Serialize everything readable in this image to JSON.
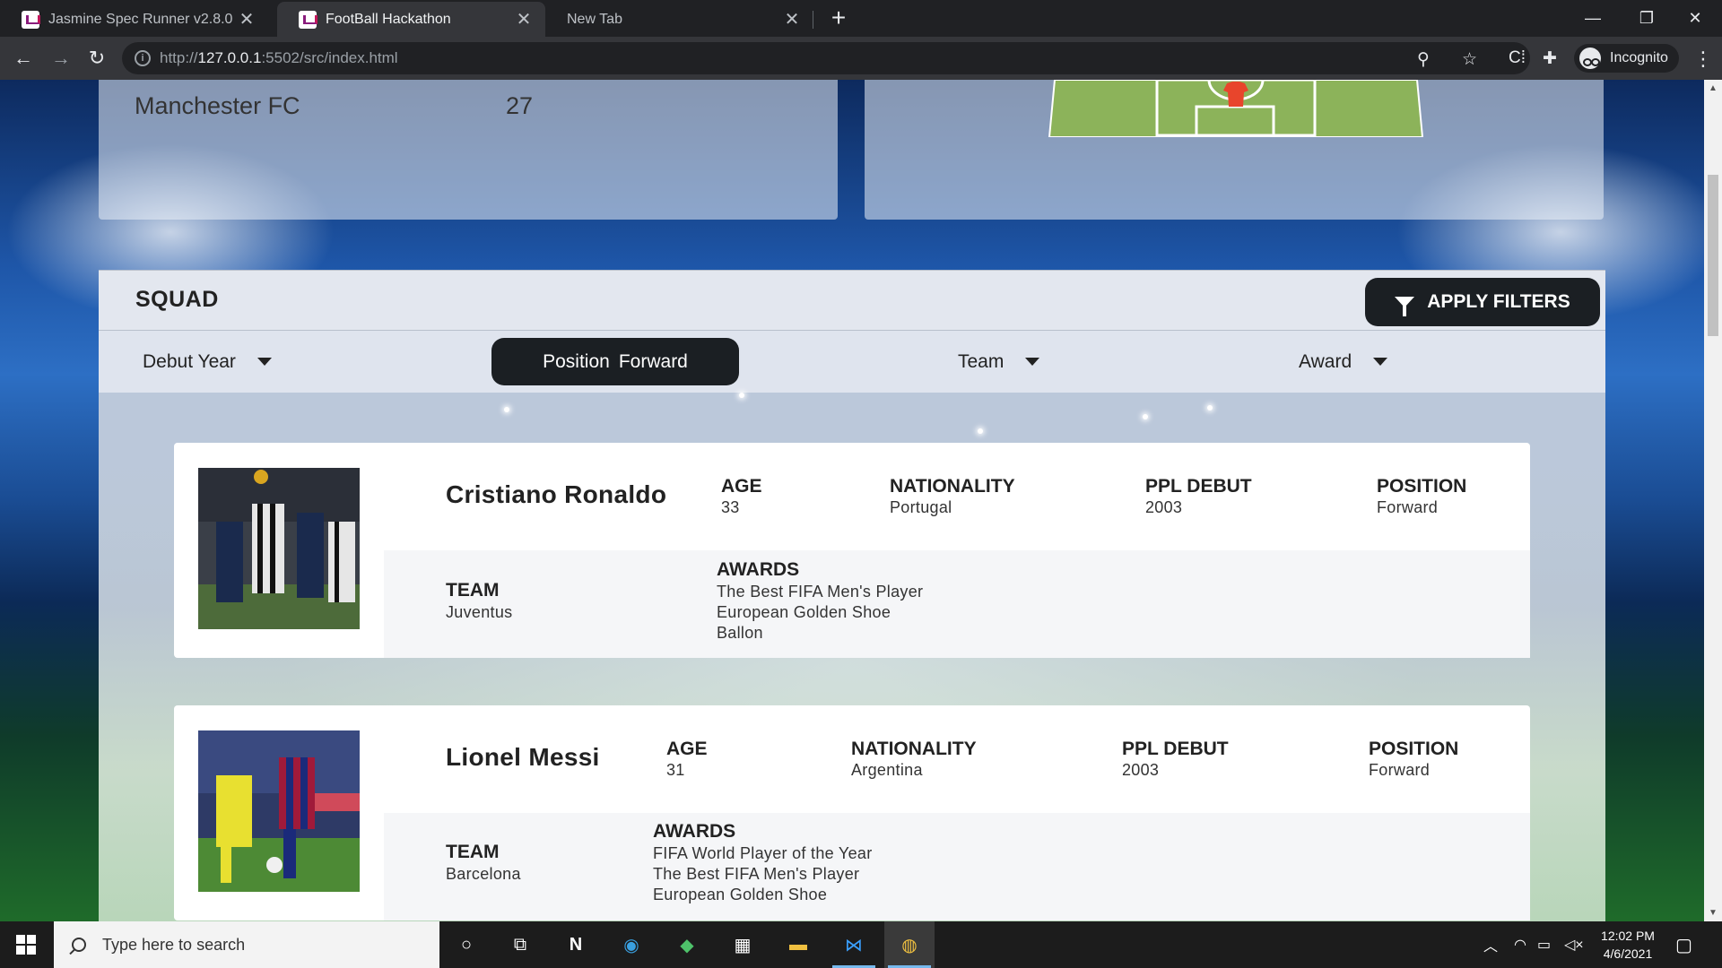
{
  "browser": {
    "tabs": [
      {
        "label": "Jasmine Spec Runner v2.8.0",
        "active": false
      },
      {
        "label": "FootBall Hackathon",
        "active": true
      },
      {
        "label": "New Tab",
        "active": false
      }
    ],
    "url_host": "127.0.0.1",
    "url_prefix": "http://",
    "url_rest": ":5502/src/index.html",
    "profile_label": "Incognito"
  },
  "team_card": {
    "name": "Manchester FC",
    "count": "27"
  },
  "squad": {
    "title": "SQUAD",
    "apply_filters_label": "APPLY FILTERS"
  },
  "filters": {
    "debut_year": "Debut Year",
    "position_label": "Position",
    "position_value": "Forward",
    "team": "Team",
    "award": "Award"
  },
  "labels": {
    "age": "AGE",
    "nationality": "NATIONALITY",
    "ppl_debut": "PPL DEBUT",
    "position": "POSITION",
    "team": "TEAM",
    "awards": "AWARDS"
  },
  "players": [
    {
      "name": "Cristiano Ronaldo",
      "age": "33",
      "nationality": "Portugal",
      "ppl_debut": "2003",
      "position": "Forward",
      "team": "Juventus",
      "awards": [
        "The Best FIFA Men's Player",
        "European Golden Shoe",
        "Ballon"
      ]
    },
    {
      "name": "Lionel Messi",
      "age": "31",
      "nationality": "Argentina",
      "ppl_debut": "2003",
      "position": "Forward",
      "team": "Barcelona",
      "awards": [
        "FIFA World Player of the Year",
        "The Best FIFA Men's Player",
        "European Golden Shoe"
      ]
    }
  ],
  "taskbar": {
    "search_placeholder": "Type here to search",
    "time": "12:02 PM",
    "date": "4/6/2021"
  },
  "colors": {
    "button_dark": "#1b1f23",
    "pitch_green": "#8cb35a",
    "jersey_red": "#e8452c"
  }
}
